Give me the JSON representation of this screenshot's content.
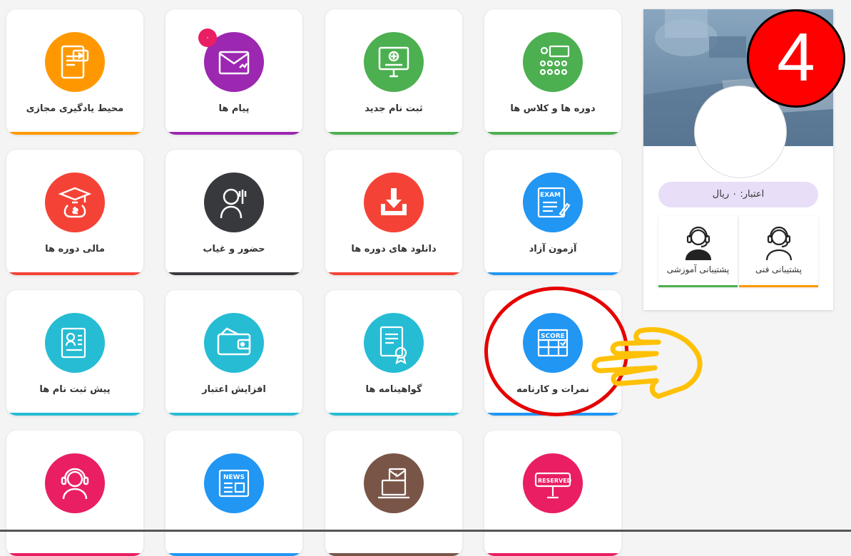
{
  "tiles": [
    {
      "label": "محیط یادگیری مجازی",
      "color": "#ff9800",
      "icon": "virtual-learning-icon"
    },
    {
      "label": "پیام ها",
      "color": "#9c27b0",
      "icon": "envelope-icon",
      "badge": "۰"
    },
    {
      "label": "ثبت نام جدید",
      "color": "#4caf50",
      "icon": "computer-registration-icon"
    },
    {
      "label": "دوره ها و کلاس ها",
      "color": "#4caf50",
      "icon": "classroom-icon"
    },
    {
      "label": "مالی دوره ها",
      "color": "#f44336",
      "icon": "money-bag-graduation-icon"
    },
    {
      "label": "حضور و غیاب",
      "color": "#37393d",
      "icon": "raised-hand-person-icon"
    },
    {
      "label": "دانلود های دوره ها",
      "color": "#f44336",
      "icon": "download-tray-icon"
    },
    {
      "label": "آزمون آزاد",
      "color": "#2196f3",
      "icon": "exam-sheet-icon"
    },
    {
      "label": "پیش ثبت نام ها",
      "color": "#26bcd4",
      "icon": "pre-registration-scroll-icon"
    },
    {
      "label": "افزایش اعتبار",
      "color": "#26bcd4",
      "icon": "wallet-icon"
    },
    {
      "label": "گواهینامه ها",
      "color": "#26bcd4",
      "icon": "certificate-icon"
    },
    {
      "label": "نمرات و کارنامه",
      "color": "#2196f3",
      "icon": "score-board-icon"
    },
    {
      "label": "",
      "color": "#e91e63",
      "icon": "support-headset-icon"
    },
    {
      "label": "",
      "color": "#2196f3",
      "icon": "news-icon"
    },
    {
      "label": "",
      "color": "#795548",
      "icon": "request-mail-laptop-icon"
    },
    {
      "label": "",
      "color": "#e91e63",
      "icon": "reserved-sign-icon"
    }
  ],
  "profile": {
    "credit_label": "اعتبار: ۰ ریال",
    "support_technical": "پشتیبانی فنی",
    "support_educational": "پشتیبانی آموزشی",
    "technical_color": "#ff9800",
    "educational_color": "#4caf50"
  },
  "annotation": {
    "step_number": "4",
    "highlight_color": "#e60000",
    "hand_color": "#ffc107"
  }
}
